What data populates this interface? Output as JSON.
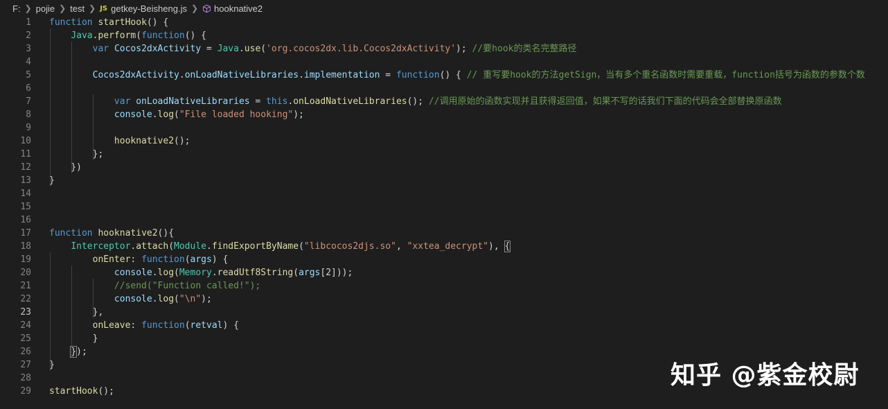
{
  "breadcrumb": {
    "drive": "F:",
    "folder1": "pojie",
    "folder2": "test",
    "file_badge": "JS",
    "file": "getkey-Beisheng.js",
    "symbol": "hooknative2"
  },
  "editor": {
    "active_line": 23,
    "lines": [
      {
        "n": "1",
        "tokens": [
          [
            "kw",
            "function"
          ],
          [
            "t",
            " "
          ],
          [
            "fn",
            "startHook"
          ],
          [
            "t",
            "() {"
          ]
        ]
      },
      {
        "n": "2",
        "tokens": [
          [
            "t",
            "    "
          ],
          [
            "cls",
            "Java"
          ],
          [
            "t",
            "."
          ],
          [
            "fn",
            "perform"
          ],
          [
            "t",
            "("
          ],
          [
            "kw",
            "function"
          ],
          [
            "t",
            "() {"
          ]
        ]
      },
      {
        "n": "3",
        "tokens": [
          [
            "t",
            "        "
          ],
          [
            "kw",
            "var"
          ],
          [
            "t",
            " "
          ],
          [
            "var",
            "Cocos2dxActivity"
          ],
          [
            "t",
            " = "
          ],
          [
            "cls",
            "Java"
          ],
          [
            "t",
            "."
          ],
          [
            "fn",
            "use"
          ],
          [
            "t",
            "("
          ],
          [
            "str",
            "'org.cocos2dx.lib.Cocos2dxActivity'"
          ],
          [
            "t",
            "); "
          ],
          [
            "com",
            "//要hook的类名完整路径"
          ]
        ]
      },
      {
        "n": "4",
        "tokens": []
      },
      {
        "n": "5",
        "tokens": [
          [
            "t",
            "        "
          ],
          [
            "var",
            "Cocos2dxActivity"
          ],
          [
            "t",
            "."
          ],
          [
            "var",
            "onLoadNativeLibraries"
          ],
          [
            "t",
            "."
          ],
          [
            "var",
            "implementation"
          ],
          [
            "t",
            " = "
          ],
          [
            "kw",
            "function"
          ],
          [
            "t",
            "() { "
          ],
          [
            "com",
            "// 重写要hook的方法getSign，当有多个重名函数时需要重载，function括号为函数的参数个数"
          ]
        ]
      },
      {
        "n": "6",
        "tokens": []
      },
      {
        "n": "7",
        "tokens": [
          [
            "t",
            "            "
          ],
          [
            "kw",
            "var"
          ],
          [
            "t",
            " "
          ],
          [
            "var",
            "onLoadNativeLibraries"
          ],
          [
            "t",
            " = "
          ],
          [
            "kw",
            "this"
          ],
          [
            "t",
            "."
          ],
          [
            "fn",
            "onLoadNativeLibraries"
          ],
          [
            "t",
            "(); "
          ],
          [
            "com",
            "//调用原始的函数实现并且获得返回值，如果不写的话我们下面的代码会全部替换原函数"
          ]
        ]
      },
      {
        "n": "8",
        "tokens": [
          [
            "t",
            "            "
          ],
          [
            "var",
            "console"
          ],
          [
            "t",
            "."
          ],
          [
            "fn",
            "log"
          ],
          [
            "t",
            "("
          ],
          [
            "str",
            "\"File loaded hooking\""
          ],
          [
            "t",
            ");"
          ]
        ]
      },
      {
        "n": "9",
        "tokens": []
      },
      {
        "n": "10",
        "tokens": [
          [
            "t",
            "            "
          ],
          [
            "fn",
            "hooknative2"
          ],
          [
            "t",
            "();"
          ]
        ]
      },
      {
        "n": "11",
        "tokens": [
          [
            "t",
            "        };"
          ]
        ]
      },
      {
        "n": "12",
        "tokens": [
          [
            "t",
            "    })"
          ]
        ]
      },
      {
        "n": "13",
        "tokens": [
          [
            "t",
            "}"
          ]
        ]
      },
      {
        "n": "14",
        "tokens": []
      },
      {
        "n": "15",
        "tokens": []
      },
      {
        "n": "16",
        "tokens": []
      },
      {
        "n": "17",
        "tokens": [
          [
            "kw",
            "function"
          ],
          [
            "t",
            " "
          ],
          [
            "fn",
            "hooknative2"
          ],
          [
            "t",
            "(){"
          ]
        ]
      },
      {
        "n": "18",
        "tokens": [
          [
            "t",
            "    "
          ],
          [
            "cls",
            "Interceptor"
          ],
          [
            "t",
            "."
          ],
          [
            "fn",
            "attach"
          ],
          [
            "t",
            "("
          ],
          [
            "cls",
            "Module"
          ],
          [
            "t",
            "."
          ],
          [
            "fn",
            "findExportByName"
          ],
          [
            "t",
            "("
          ],
          [
            "str",
            "\"libcocos2djs.so\""
          ],
          [
            "t",
            ", "
          ],
          [
            "str",
            "\"xxtea_decrypt\""
          ],
          [
            "t",
            "), "
          ],
          [
            "br",
            "{"
          ]
        ]
      },
      {
        "n": "19",
        "tokens": [
          [
            "t",
            "        "
          ],
          [
            "fn",
            "onEnter"
          ],
          [
            "t",
            ": "
          ],
          [
            "kw",
            "function"
          ],
          [
            "t",
            "("
          ],
          [
            "var",
            "args"
          ],
          [
            "t",
            ") {"
          ]
        ]
      },
      {
        "n": "20",
        "tokens": [
          [
            "t",
            "            "
          ],
          [
            "var",
            "console"
          ],
          [
            "t",
            "."
          ],
          [
            "fn",
            "log"
          ],
          [
            "t",
            "("
          ],
          [
            "cls",
            "Memory"
          ],
          [
            "t",
            "."
          ],
          [
            "fn",
            "readUtf8String"
          ],
          [
            "t",
            "("
          ],
          [
            "var",
            "args"
          ],
          [
            "t",
            "[2]));"
          ]
        ]
      },
      {
        "n": "21",
        "tokens": [
          [
            "t",
            "            "
          ],
          [
            "com",
            "//send(\"Function called!\");"
          ]
        ]
      },
      {
        "n": "22",
        "tokens": [
          [
            "t",
            "            "
          ],
          [
            "var",
            "console"
          ],
          [
            "t",
            "."
          ],
          [
            "fn",
            "log"
          ],
          [
            "t",
            "("
          ],
          [
            "str",
            "\"\\n\""
          ],
          [
            "t",
            ");"
          ]
        ]
      },
      {
        "n": "23",
        "tokens": [
          [
            "t",
            "        },"
          ]
        ]
      },
      {
        "n": "24",
        "tokens": [
          [
            "t",
            "        "
          ],
          [
            "fn",
            "onLeave"
          ],
          [
            "t",
            ": "
          ],
          [
            "kw",
            "function"
          ],
          [
            "t",
            "("
          ],
          [
            "var",
            "retval"
          ],
          [
            "t",
            ") {"
          ]
        ]
      },
      {
        "n": "25",
        "tokens": [
          [
            "t",
            "        }"
          ]
        ]
      },
      {
        "n": "26",
        "tokens": [
          [
            "t",
            "    "
          ],
          [
            "br",
            "}"
          ],
          [
            "t",
            ");"
          ]
        ]
      },
      {
        "n": "27",
        "tokens": [
          [
            "t",
            "}"
          ]
        ]
      },
      {
        "n": "28",
        "tokens": []
      },
      {
        "n": "29",
        "tokens": [
          [
            "fn",
            "startHook"
          ],
          [
            "t",
            "();"
          ]
        ]
      }
    ]
  },
  "watermark": "知乎 @紫金校尉"
}
